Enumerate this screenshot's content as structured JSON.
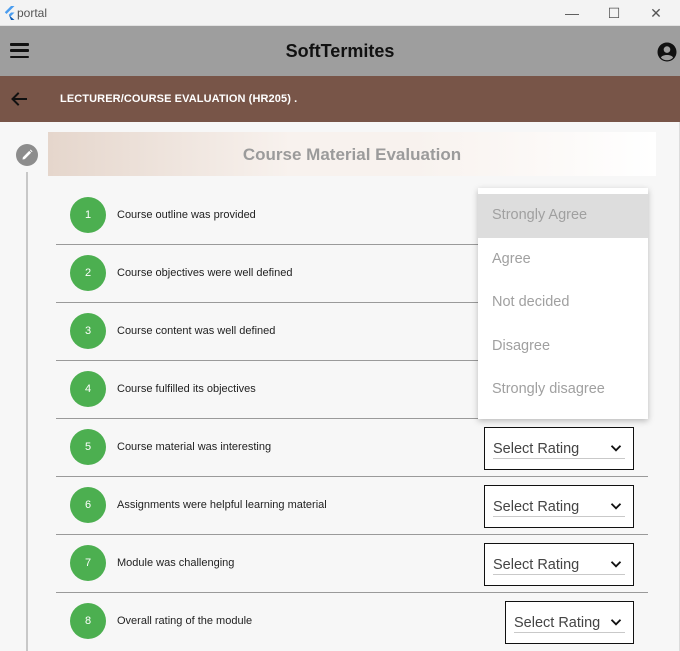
{
  "window": {
    "title": "portal",
    "minimize_glyph": "—",
    "maximize_glyph": "☐",
    "close_glyph": "✕"
  },
  "appbar": {
    "title": "SoftTermites"
  },
  "subheader": {
    "title": "LECTURER/COURSE EVALUATION (HR205) ."
  },
  "section": {
    "title": "Course Material Evaluation"
  },
  "questions": [
    {
      "number": "1",
      "text": "Course outline was provided"
    },
    {
      "number": "2",
      "text": "Course objectives were well defined"
    },
    {
      "number": "3",
      "text": "Course content was well defined"
    },
    {
      "number": "4",
      "text": "Course fulfilled its objectives"
    },
    {
      "number": "5",
      "text": "Course material was interesting",
      "rating": "Select Rating"
    },
    {
      "number": "6",
      "text": "Assignments were helpful learning material",
      "rating": "Select Rating"
    },
    {
      "number": "7",
      "text": "Module was challenging",
      "rating": "Select Rating"
    },
    {
      "number": "8",
      "text": "Overall rating of the module",
      "rating": "Select Rating"
    }
  ],
  "dropdown": {
    "options": [
      "Strongly Agree",
      "Agree",
      "Not decided",
      "Disagree",
      "Strongly disagree"
    ],
    "highlighted": "Strongly Agree"
  },
  "colors": {
    "appbar": "#9e9e9e",
    "subheader": "#785548",
    "question_badge": "#4caf50",
    "logo": "#4a9df0"
  },
  "icons": {
    "logo": "flutter-logo-icon",
    "menu": "hamburger-menu-icon",
    "account": "account-circle-icon",
    "back": "arrow-back-icon",
    "edit": "pencil-icon",
    "select": "caret-down-icon"
  }
}
